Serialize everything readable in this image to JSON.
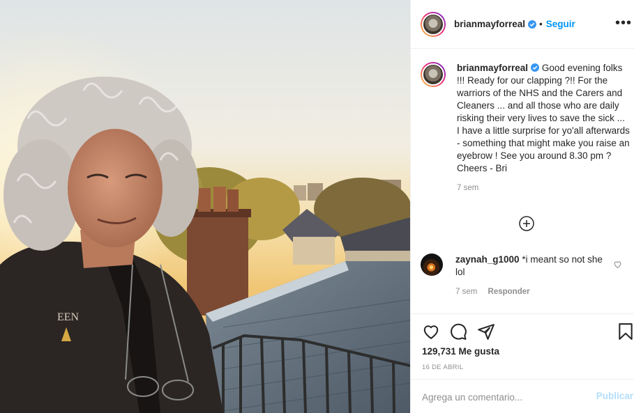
{
  "post": {
    "image_alt": "Selfie on a rooftop at sunset",
    "author": {
      "username": "brianmayforreal",
      "verified": true,
      "separator": "•",
      "follow_label": "Seguir"
    },
    "more_icon": "more-options-icon",
    "caption": {
      "username": "brianmayforreal",
      "text": "Good evening folks !!! Ready for our clapping ?!! For the warriors of the NHS and the Carers and Cleaners ... and all those who are daily risking their very lives to save the sick ... I have a little surprise for yo'all afterwards - something that might make you raise an eyebrow ! See you around 8.30 pm ? Cheers - Bri",
      "time": "7 sem"
    },
    "load_more_icon": "load-more-comments-icon",
    "comments": [
      {
        "username": "zaynah_g1000",
        "text": "*i meant so not she lol",
        "time": "7 sem",
        "reply_label": "Responder"
      }
    ],
    "actions": {
      "like_icon": "heart-icon",
      "comment_icon": "comment-icon",
      "share_icon": "share-icon",
      "save_icon": "bookmark-icon"
    },
    "likes_label": "129,731 Me gusta",
    "date": "16 DE ABRIL",
    "add_comment": {
      "placeholder": "Agrega un comentario...",
      "publish_label": "Publicar"
    }
  },
  "colors": {
    "accent": "#0095f6",
    "publish_disabled": "#b2dffc",
    "muted_text": "#8e8e8e",
    "border": "#efefef"
  }
}
